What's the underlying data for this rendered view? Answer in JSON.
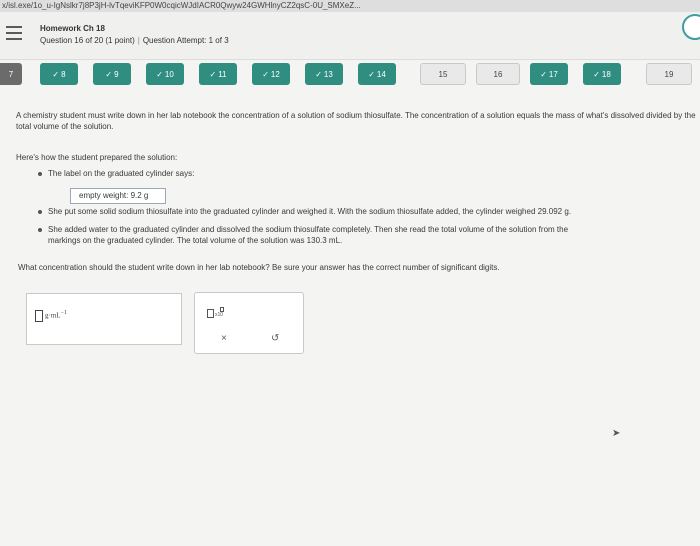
{
  "url": "x/isl.exe/1o_u-IgNslkr7j8P3jH-lvTqeviKFP0W0cqicWJdIACR0Qwyw24GWHlnyCZ2qsC-0U_SMXeZ...",
  "header": {
    "title": "Homework Ch 18",
    "question": "Question 16 of 20 (1 point)",
    "attempt": "Question Attempt: 1 of 3"
  },
  "nav": {
    "items": [
      {
        "num": "7",
        "checked": false
      },
      {
        "num": "8",
        "checked": true
      },
      {
        "num": "9",
        "checked": true
      },
      {
        "num": "10",
        "checked": true
      },
      {
        "num": "11",
        "checked": true
      },
      {
        "num": "12",
        "checked": true
      },
      {
        "num": "13",
        "checked": true
      },
      {
        "num": "14",
        "checked": true
      },
      {
        "num": "15",
        "checked": false
      },
      {
        "num": "16",
        "checked": false
      },
      {
        "num": "17",
        "checked": true
      },
      {
        "num": "18",
        "checked": true
      },
      {
        "num": "19",
        "checked": false
      }
    ]
  },
  "question": {
    "intro": "A chemistry student must write down in her lab notebook the concentration of a solution of sodium thiosulfate. The concentration of a solution equals the mass of what's dissolved divided by the total volume of the solution.",
    "prep": "Here's how the student prepared the solution:",
    "bullet1": "The label on the graduated cylinder says:",
    "label_box": "empty weight: 9.2 g",
    "bullet2": "She put some solid sodium thiosulfate into the graduated cylinder and weighed it. With the sodium thiosulfate added, the cylinder weighed 29.092 g.",
    "bullet3a": "She added water to the graduated cylinder and dissolved the sodium thiosulfate completely. Then she read the total volume of the solution from the",
    "bullet3b": "markings on the graduated cylinder. The total volume of the solution was 130.3 mL.",
    "ask": "What concentration should the student write down in her lab notebook? Be sure your answer has the correct number of significant digits."
  },
  "answer": {
    "unit": "g·mL",
    "exponent": "−1",
    "value": ""
  },
  "tools": {
    "clear_label": "×",
    "undo_label": "↺"
  }
}
